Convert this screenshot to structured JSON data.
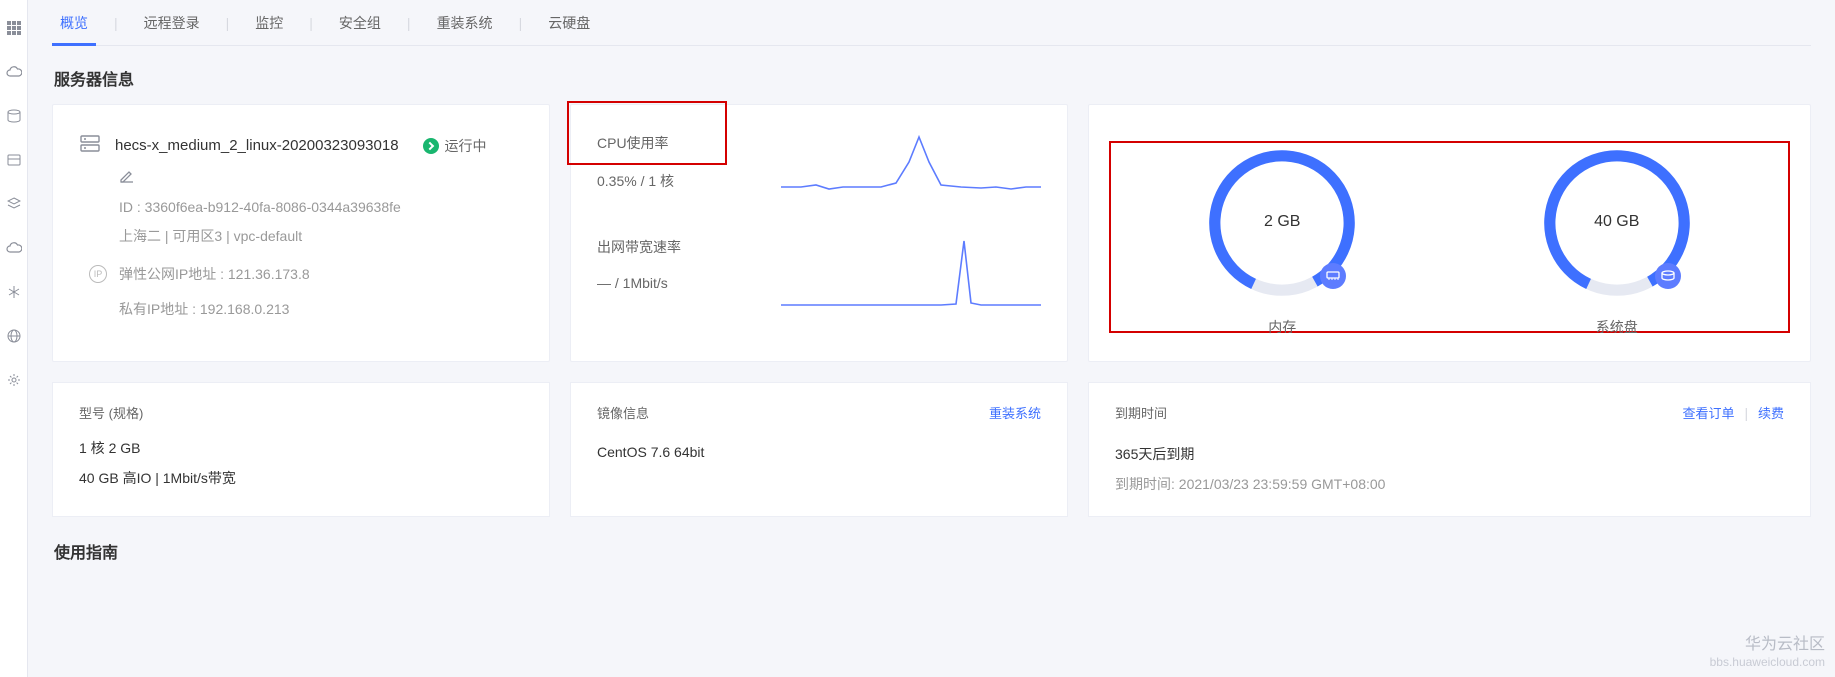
{
  "tabs": {
    "overview": "概览",
    "remote": "远程登录",
    "monitor": "监控",
    "security": "安全组",
    "reinstall": "重装系统",
    "disk": "云硬盘"
  },
  "section": {
    "serverinfo": "服务器信息",
    "guide": "使用指南"
  },
  "server": {
    "name": "hecs-x_medium_2_linux-20200323093018",
    "status": "运行中",
    "id_label": "ID : 3360f6ea-b912-40fa-8086-0344a39638fe",
    "region": "上海二 | 可用区3 | vpc-default",
    "eip_label": "弹性公网IP地址 : 121.36.173.8",
    "private_ip": "私有IP地址 : 192.168.0.213"
  },
  "metrics": {
    "cpu_label": "CPU使用率",
    "cpu_value": "0.35% / 1 核",
    "net_label": "出网带宽速率",
    "net_value": "— / 1Mbit/s"
  },
  "gauges": {
    "mem_value": "2 GB",
    "mem_label": "内存",
    "disk_value": "40 GB",
    "disk_label": "系统盘"
  },
  "spec": {
    "title": "型号 (规格)",
    "line1": "1 核 2 GB",
    "line2": "40 GB 高IO | 1Mbit/s带宽"
  },
  "image": {
    "title": "镜像信息",
    "value": "CentOS 7.6 64bit",
    "action": "重装系统"
  },
  "expiry": {
    "title": "到期时间",
    "value": "365天后到期",
    "detail": "到期时间: 2021/03/23 23:59:59 GMT+08:00",
    "view_order": "查看订单",
    "renew": "续费"
  },
  "watermark": {
    "line1": "华为云社区",
    "line2": "bbs.huaweicloud.com"
  },
  "chart_data": [
    {
      "type": "line",
      "title": "CPU使用率",
      "ylim": [
        0,
        1
      ],
      "values": [
        0.15,
        0.15,
        0.14,
        0.18,
        0.14,
        0.15,
        0.15,
        0.22,
        0.5,
        0.95,
        0.5,
        0.18,
        0.15,
        0.16,
        0.15,
        0.13,
        0.15,
        0.15
      ]
    },
    {
      "type": "line",
      "title": "出网带宽速率",
      "ylim": [
        0,
        1
      ],
      "values": [
        0.02,
        0.02,
        0.02,
        0.02,
        0.02,
        0.02,
        0.02,
        0.02,
        0.02,
        0.02,
        0.02,
        0.03,
        0.95,
        0.04,
        0.02,
        0.02,
        0.02,
        0.02
      ]
    }
  ]
}
